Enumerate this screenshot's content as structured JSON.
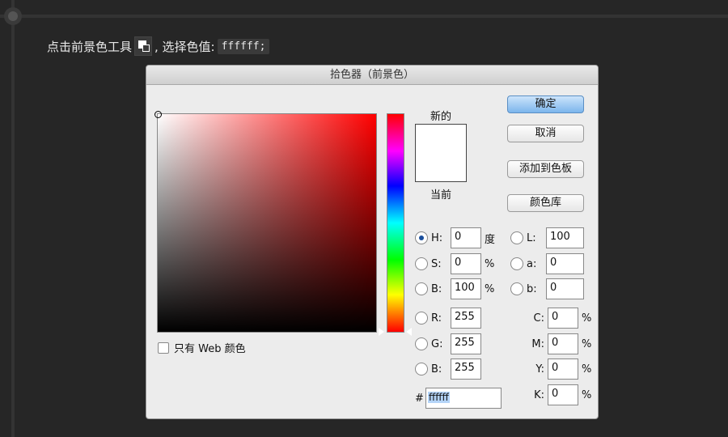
{
  "instruction": {
    "prefix": "点击前景色工具",
    "mid": ", 选择色值:",
    "code": "ffffff;"
  },
  "dialog": {
    "title": "拾色器（前景色）",
    "web_only_label": "只有 Web 颜色",
    "new_label": "新的",
    "current_label": "当前",
    "buttons": {
      "ok": "确定",
      "cancel": "取消",
      "add_swatch": "添加到色板",
      "libraries": "颜色库"
    },
    "hsb": {
      "h_label": "H:",
      "h_value": "0",
      "h_unit": "度",
      "s_label": "S:",
      "s_value": "0",
      "s_unit": "%",
      "b_label": "B:",
      "b_value": "100",
      "b_unit": "%"
    },
    "rgb": {
      "r_label": "R:",
      "r_value": "255",
      "g_label": "G:",
      "g_value": "255",
      "b_label": "B:",
      "b_value": "255"
    },
    "lab": {
      "l_label": "L:",
      "l_value": "100",
      "a_label": "a:",
      "a_value": "0",
      "b_label": "b:",
      "b_value": "0"
    },
    "cmyk": {
      "c_label": "C:",
      "c_value": "0",
      "c_unit": "%",
      "m_label": "M:",
      "m_value": "0",
      "m_unit": "%",
      "y_label": "Y:",
      "y_value": "0",
      "y_unit": "%",
      "k_label": "K:",
      "k_value": "0",
      "k_unit": "%"
    },
    "hex": {
      "hash": "#",
      "value": "ffffff"
    },
    "colors": {
      "new_swatch": "#ffffff",
      "current_swatch": "#ffffff"
    }
  }
}
